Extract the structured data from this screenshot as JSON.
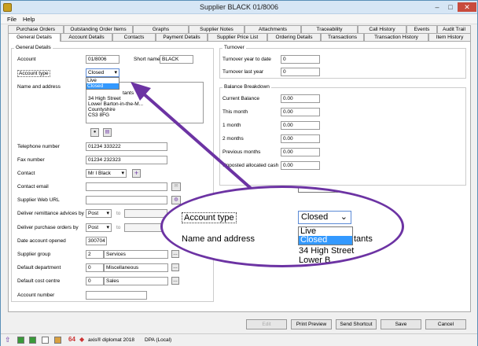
{
  "window": {
    "title": "Supplier BLACK 01/8006"
  },
  "menu": [
    "File",
    "Help"
  ],
  "tabs_top": [
    "Purchase Orders",
    "Outstanding Order Items",
    "Graphs",
    "Supplier Notes",
    "Attachments",
    "Traceability",
    "Call History",
    "Events",
    "Audit Trail"
  ],
  "tabs_bottom": [
    "General Details",
    "Account Details",
    "Contacts",
    "Payment Details",
    "Supplier Price List",
    "Ordering Details",
    "Transactions",
    "Transaction History",
    "Item History"
  ],
  "general": {
    "group_title": "General Details",
    "account_label": "Account",
    "account_value": "01/8006",
    "short_name_label": "Short name",
    "short_name_value": "BLACK",
    "account_type_label": "Account type",
    "account_type_value": "Closed",
    "account_type_options": [
      "Live",
      "Closed"
    ],
    "name_address_label": "Name and address",
    "address_lines": [
      "tants",
      "34 High Street",
      "Lower Barton-in-the-M...",
      "Countyshire",
      "CS3 8FG"
    ],
    "telephone_label": "Telephone number",
    "telephone_value": "01234 333222",
    "fax_label": "Fax number",
    "fax_value": "01234 232323",
    "contact_label": "Contact",
    "contact_value": "Mr I Black",
    "contact_email_label": "Contact email",
    "web_label": "Supplier Web URL",
    "remit_label": "Deliver remittance advices by",
    "remit_value": "Post",
    "purchase_label": "Deliver purchase orders by",
    "purchase_value": "Post",
    "to_label": "to",
    "date_opened_label": "Date account opened",
    "date_opened_value": "300704",
    "group_label": "Supplier group",
    "group_code": "2",
    "group_name": "Services",
    "dept_label": "Default department",
    "dept_code": "0",
    "dept_name": "Miscellaneous",
    "cost_label": "Default cost centre",
    "cost_code": "0",
    "cost_name": "Sales",
    "acctnum_label": "Account number"
  },
  "turnover": {
    "group_title": "Turnover",
    "ytd_label": "Turnover year to date",
    "ytd_value": "0",
    "last_label": "Turnover last year",
    "last_value": "0"
  },
  "balance": {
    "group_title": "Balance Breakdown",
    "current_label": "Current Balance",
    "current_value": "0.00",
    "this_month_label": "This month",
    "this_month_value": "0.00",
    "m1_label": "1 month",
    "m1_value": "0.00",
    "m2_label": "2 months",
    "m2_value": "0.00",
    "prev_label": "Previous months",
    "prev_value": "0.00",
    "unposted_label": "Unposted allocated cash",
    "unposted_value": "0.00"
  },
  "buttons": {
    "edit": "Edit",
    "print_preview": "Print Preview",
    "send_shortcut": "Send Shortcut",
    "save": "Save",
    "cancel": "Cancel"
  },
  "status": {
    "app": "axis® diplomat 2018",
    "db": "DPA (Local)"
  },
  "zoom": {
    "account_type_label": "Account type",
    "selected": "Closed",
    "options": [
      "Live",
      "Closed"
    ],
    "name_address_label": "Name and address",
    "addr_line1": "34 High Street",
    "addr_line2": "Lower B...",
    "addr_frag": "tants"
  },
  "colors": {
    "highlight": "#3399ff",
    "callout": "#6c33a3"
  }
}
